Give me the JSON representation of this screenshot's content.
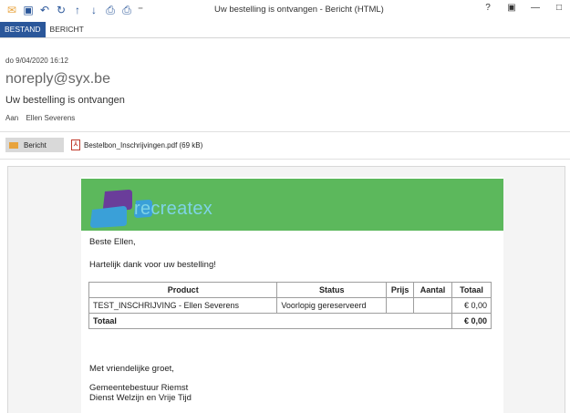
{
  "window": {
    "title": "Uw bestelling is ontvangen  -  Bericht (HTML)",
    "help": "?",
    "quick_access": [
      "envelope-icon",
      "save-icon",
      "undo-icon",
      "redo-icon",
      "up-arrow-icon",
      "down-arrow-icon",
      "print-icon",
      "print-preview-icon",
      "customize-icon"
    ]
  },
  "ribbon": {
    "tabs": [
      {
        "label": "BESTAND",
        "active": true
      },
      {
        "label": "BERICHT",
        "active": false
      }
    ]
  },
  "message": {
    "date": "do 9/04/2020 16:12",
    "from": "noreply@syx.be",
    "subject": "Uw bestelling is ontvangen",
    "to_label": "Aan",
    "to_value": "Ellen Severens"
  },
  "attachments": {
    "message_label": "Bericht",
    "file": "Bestelbon_Inschrijvingen.pdf (69 kB)"
  },
  "email": {
    "brand": "recreatex",
    "greeting": "Beste Ellen,",
    "thanks": "Hartelijk dank voor uw bestelling!",
    "table": {
      "headers": [
        "Product",
        "Status",
        "Prijs",
        "Aantal",
        "Totaal"
      ],
      "rows": [
        [
          "TEST_INSCHRIJVING - Ellen Severens",
          "Voorlopig gereserveerd",
          "",
          "",
          "€ 0,00"
        ]
      ],
      "total_label": "Totaal",
      "total_value": "€ 0,00"
    },
    "closing": "Met vriendelijke groet,",
    "signature_line1": "Gemeentebestuur Riemst",
    "signature_line2": "Dienst Welzijn en Vrije Tijd"
  },
  "colors": {
    "ribbon_active": "#2b579a",
    "banner": "#5cb85c",
    "brand_text": "#7fd3e6",
    "logo_dark": "#6a3d9a",
    "logo_light": "#3aa0d8"
  }
}
